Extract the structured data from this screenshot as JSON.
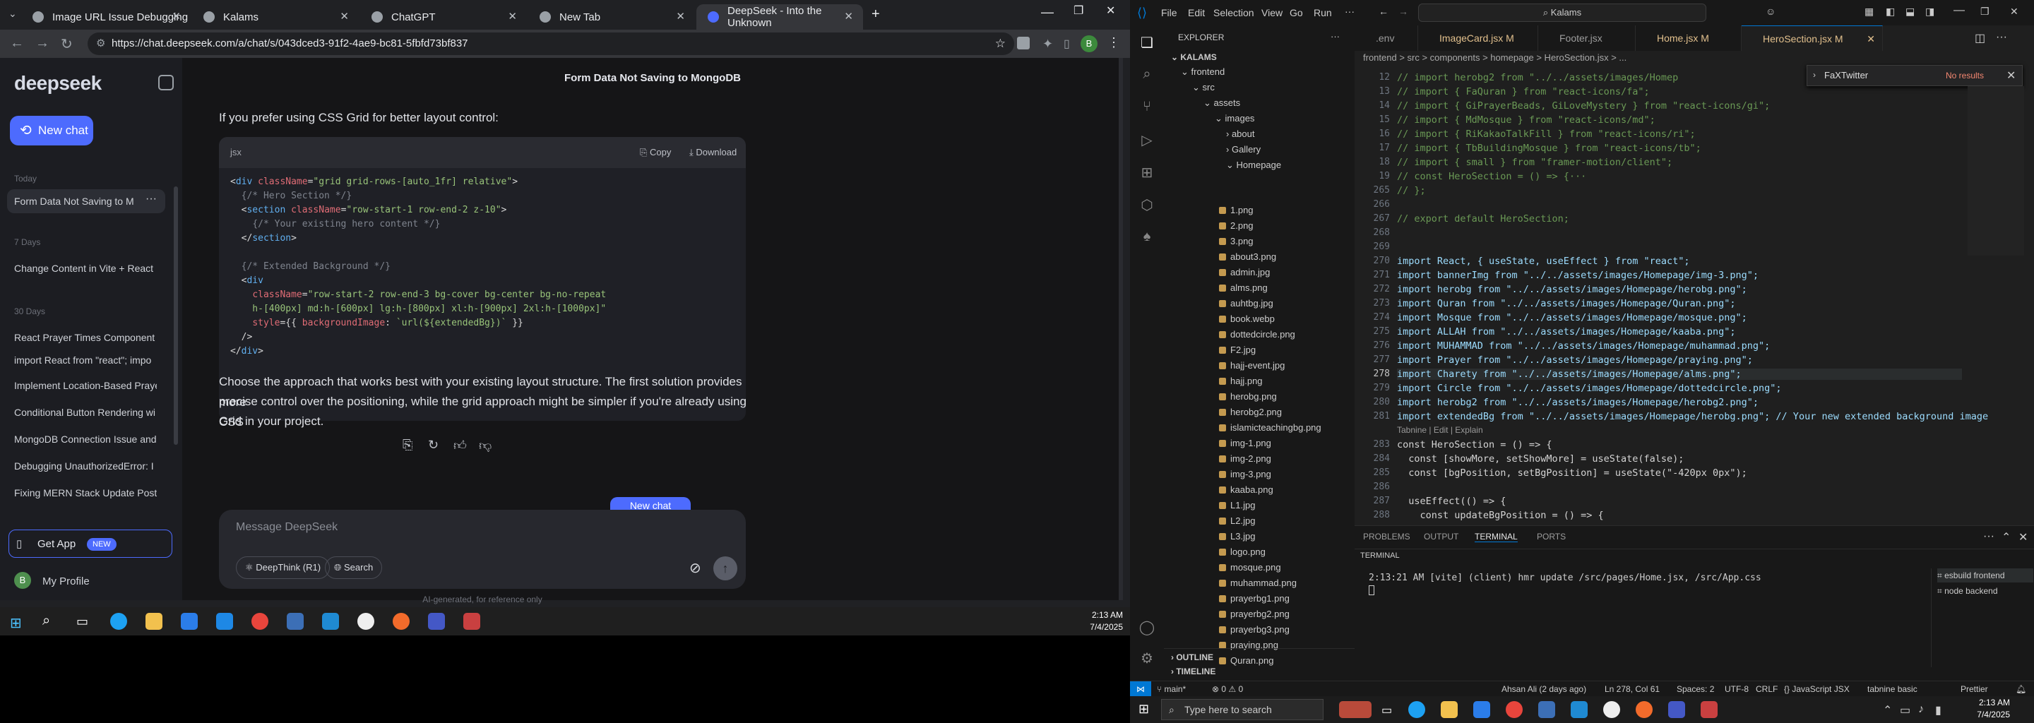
{
  "browser": {
    "tabs": [
      "Image URL Issue Debugging",
      "Kalams",
      "ChatGPT",
      "New Tab",
      "DeepSeek - Into the Unknown"
    ],
    "url": "https://chat.deepseek.com/a/chat/s/043dced3-91f2-4ae9-bc81-5fbfd73bf837"
  },
  "deepseek": {
    "logo": "deepseek",
    "new_chat": "New chat",
    "sections": {
      "today": "Today",
      "d7": "7 Days",
      "d30": "30 Days"
    },
    "history": [
      "Form Data Not Saving to M",
      "Change Content in Vite + React",
      "React Prayer Times Component",
      "import React from \"react\"; impo",
      "Implement Location-Based Praye",
      "Conditional Button Rendering wi",
      "MongoDB Connection Issue and",
      "Debugging UnauthorizedError: I",
      "Fixing MERN Stack Update Post I"
    ],
    "get_app": "Get App",
    "new_badge": "NEW",
    "profile": "My Profile",
    "profile_initial": "B",
    "chat_title": "Form Data Not Saving to MongoDB",
    "intro": "If you prefer using CSS Grid for better layout control:",
    "code_lang": "jsx",
    "copy": "Copy",
    "download": "Download",
    "conclusion_1": "Choose the approach that works best with your existing layout structure. The first solution provides more",
    "conclusion_2": "precise control over the positioning, while the grid approach might be simpler if you're already using CSS",
    "conclusion_3": "Grid in your project.",
    "float_new_chat": "New chat",
    "placeholder": "Message DeepSeek",
    "deepthink": "DeepThink (R1)",
    "search": "Search",
    "disclaimer": "AI-generated, for reference only"
  },
  "left_taskbar": {
    "time": "2:13 AM",
    "date": "7/4/2025"
  },
  "vscode": {
    "menu": [
      "File",
      "Edit",
      "Selection",
      "View",
      "Go",
      "Run"
    ],
    "search_box": "Kalams",
    "explorer_title": "EXPLORER",
    "project": "KALAMS",
    "folders": {
      "frontend": "frontend",
      "src": "src",
      "assets": "assets",
      "images": "images",
      "about": "about",
      "gallery": "Gallery",
      "homepage": "Homepage"
    },
    "files": [
      "1.png",
      "2.png",
      "3.png",
      "about3.png",
      "admin.jpg",
      "alms.png",
      "auhtbg.jpg",
      "book.webp",
      "dottedcircle.png",
      "F2.jpg",
      "hajj-event.jpg",
      "hajj.png",
      "herobg.png",
      "herobg2.png",
      "islamicteachingbg.png",
      "img-1.png",
      "img-2.png",
      "img-3.png",
      "kaaba.png",
      "L1.jpg",
      "L2.jpg",
      "L3.jpg",
      "logo.png",
      "mosque.png",
      "muhammad.png",
      "prayerbg1.png",
      "prayerbg2.png",
      "prayerbg3.png",
      "praying.png",
      "Quran.png"
    ],
    "outline": "OUTLINE",
    "timeline": "TIMELINE",
    "editor_tabs": [
      ".env",
      "ImageCard.jsx M",
      "Footer.jsx",
      "Home.jsx M",
      "HeroSection.jsx M"
    ],
    "breadcrumb": "frontend > src > components > homepage > HeroSection.jsx > ...",
    "find_text": "FaXTwitter",
    "find_result": "No results",
    "lines": [
      {
        "n": "12",
        "t": "// import herobg2 from \"../../assets/images/Homep"
      },
      {
        "n": "13",
        "t": "// import { FaQuran } from \"react-icons/fa\";"
      },
      {
        "n": "14",
        "t": "// import { GiPrayerBeads, GiLoveMystery } from \"react-icons/gi\";"
      },
      {
        "n": "15",
        "t": "// import { MdMosque } from \"react-icons/md\";"
      },
      {
        "n": "16",
        "t": "// import { RiKakaoTalkFill } from \"react-icons/ri\";"
      },
      {
        "n": "17",
        "t": "// import { TbBuildingMosque } from \"react-icons/tb\";"
      },
      {
        "n": "18",
        "t": "// import { small } from \"framer-motion/client\";"
      },
      {
        "n": "19",
        "t": "// const HeroSection = () => {···"
      },
      {
        "n": "265",
        "t": "// };"
      },
      {
        "n": "266",
        "t": ""
      },
      {
        "n": "267",
        "t": "// export default HeroSection;"
      },
      {
        "n": "268",
        "t": ""
      },
      {
        "n": "269",
        "t": ""
      },
      {
        "n": "270",
        "t": "import React, { useState, useEffect } from \"react\";"
      },
      {
        "n": "271",
        "t": "import bannerImg from \"../../assets/images/Homepage/img-3.png\";"
      },
      {
        "n": "272",
        "t": "import herobg from \"../../assets/images/Homepage/herobg.png\";"
      },
      {
        "n": "273",
        "t": "import Quran from \"../../assets/images/Homepage/Quran.png\";"
      },
      {
        "n": "274",
        "t": "import Mosque from \"../../assets/images/Homepage/mosque.png\";"
      },
      {
        "n": "275",
        "t": "import ALLAH from \"../../assets/images/Homepage/kaaba.png\";"
      },
      {
        "n": "276",
        "t": "import MUHAMMAD from \"../../assets/images/Homepage/muhammad.png\";"
      },
      {
        "n": "277",
        "t": "import Prayer from \"../../assets/images/Homepage/praying.png\";"
      },
      {
        "n": "278",
        "t": "import Charety from \"../../assets/images/Homepage/alms.png\";"
      },
      {
        "n": "279",
        "t": "import Circle from \"../../assets/images/Homepage/dottedcircle.png\";"
      },
      {
        "n": "280",
        "t": "import herobg2 from \"../../assets/images/Homepage/herobg2.png\";"
      },
      {
        "n": "281",
        "t": "import extendedBg from \"../../assets/images/Homepage/herobg.png\"; // Your new extended background image"
      },
      {
        "n": "",
        "t": "Tabnine | Edit | Explain"
      },
      {
        "n": "283",
        "t": "const HeroSection = () => {"
      },
      {
        "n": "284",
        "t": "  const [showMore, setShowMore] = useState(false);"
      },
      {
        "n": "285",
        "t": "  const [bgPosition, setBgPosition] = useState(\"-420px 0px\");"
      },
      {
        "n": "286",
        "t": ""
      },
      {
        "n": "287",
        "t": "  useEffect(() => {"
      },
      {
        "n": "288",
        "t": "    const updateBgPosition = () => {"
      }
    ],
    "panel_tabs": [
      "PROBLEMS",
      "OUTPUT",
      "TERMINAL",
      "PORTS"
    ],
    "terminal_label": "TERMINAL",
    "terminal_line": "2:13:21 AM [vite] (client) hmr update /src/pages/Home.jsx, /src/App.css",
    "terminals": [
      "esbuild  frontend",
      "node  backend"
    ],
    "status_left": "main*",
    "status_errors": "0 ⚠ 0",
    "status_right": [
      "Ahsan Ali (2 days ago)",
      "Ln 278, Col 61",
      "Spaces: 2",
      "UTF-8",
      "CRLF",
      "{} JavaScript JSX",
      "tabnine basic",
      "Prettier"
    ]
  },
  "right_taskbar": {
    "search": "Type here to search",
    "time": "2:13 AM",
    "date": "7/4/2025"
  },
  "colors": {
    "ds_blue": "#4d6bfe",
    "vs_blue": "#0078d4"
  }
}
